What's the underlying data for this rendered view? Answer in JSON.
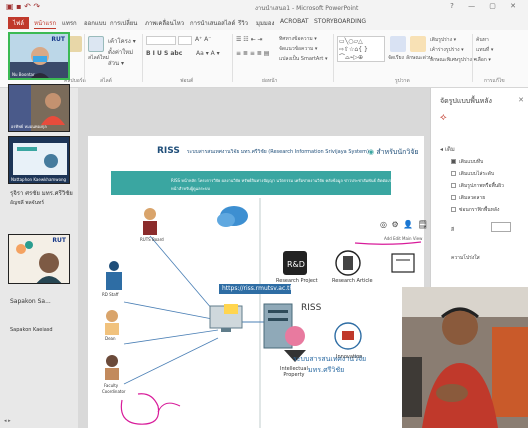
{
  "titlebar": {
    "title": "งานนำเสนอ1 - Microsoft PowerPoint",
    "window_buttons": "? — ▢ ✕"
  },
  "ribbon_tabs": [
    {
      "label": "ไฟล์",
      "kind": "file"
    },
    {
      "label": "หน้าแรก",
      "kind": "active"
    },
    {
      "label": "แทรก"
    },
    {
      "label": "ออกแบบ"
    },
    {
      "label": "การเปลี่ยน"
    },
    {
      "label": "ภาพเคลื่อนไหว"
    },
    {
      "label": "การนำเสนอสไลด์"
    },
    {
      "label": "รีวิว"
    },
    {
      "label": "มุมมอง"
    },
    {
      "label": "ACROBAT"
    },
    {
      "label": "STORYBOARDING"
    }
  ],
  "ribbon": {
    "groups": [
      {
        "label": "คลิปบอร์ด"
      },
      {
        "label": "สไลด์"
      },
      {
        "label": "ฟอนต์"
      },
      {
        "label": "ย่อหน้า"
      },
      {
        "label": "รูปวาด"
      },
      {
        "label": "การแก้ไข"
      }
    ],
    "tools": {
      "new_slide": "สไลด์ใหม่",
      "layout": "เค้าโครง ▾",
      "reset": "ตั้งค่าใหม่",
      "section": "ส่วน ▾",
      "text_direction": "ทิศทางข้อความ ▾",
      "align_text": "จัดแนวข้อความ ▾",
      "smartart": "แปลงเป็น SmartArt ▾",
      "arrange": "จัดเรียง",
      "quick_styles": "ลักษณะด่วน",
      "shape_fill": "เติมรูปร่าง ▾",
      "shape_outline": "เค้าร่างรูปร่าง ▾",
      "shape_effects": "ลักษณะพิเศษรูปร่าง ▾",
      "find": "ค้นหา",
      "replace": "แทนที่ ▾",
      "select": "เลือก ▾"
    }
  },
  "participants": [
    {
      "name": "Nu Boontar",
      "active": true
    },
    {
      "name": "อรทิพย์ หมอนทองกุล"
    },
    {
      "name": "Nattaphon Kaewkhamwong"
    },
    {
      "name": "อัญชลี พลจันทร์"
    }
  ],
  "participant_labels": {
    "label1": "รุจิรา ศรชัย มทร.ศรีวิชัย",
    "label2": "Sapakon Sa...",
    "label3": "Sapakon Kaeiasd"
  },
  "slide": {
    "logo": "RISS",
    "header_title": "ระบบสารสนเทศงานวิจัย มทร.ศรีวิชัย (Research Information Srivijaya System)",
    "researcher_button": "สำหรับนักวิจัย",
    "menu_items": "RISS   หน้าหลัก   โครงการวิจัย   ผลงานวิจัย   ทรัพย์สินทางปัญญา   นวัตกรรม   เครือข่ายงานวิจัย   คลังข้อมูล   ข่าวประชาสัมพันธ์   ติดต่อเรา",
    "menu_sub": "หน้าสำหรับผู้ดูแลระบบ",
    "right_icons": "◎ ⚙ 👤 🗒 👥",
    "add_edit": "Add Edit Main        View",
    "url": "https://riss.rmutsv.ac.th/",
    "server_label": "RISS",
    "system_label_1": "ระบบสารสนเทศงานวิจัย",
    "system_label_2": "มทร.ศรีวิชัย",
    "nodes": {
      "ruts_board": "RUTS Board",
      "rd_staff": "RD Staff",
      "dean": "Dean",
      "faculty": "Faculty",
      "coordinator": "Coordinator",
      "research_project": "Research Project",
      "research_article": "Research Article",
      "intellectual_property": "Intellectual\nProperty",
      "innovation": "Innovation"
    }
  },
  "right_pane": {
    "header": "จัดรูปแบบพื้นหลัง",
    "close": "✕",
    "fill_header": "◂ เติม",
    "options": [
      {
        "label": "เติมแบบทึบ",
        "checked": true
      },
      {
        "label": "เติมแบบไล่ระดับ"
      },
      {
        "label": "เติมรูปภาพหรือพื้นผิว"
      },
      {
        "label": "เติมลวดลาย"
      },
      {
        "label": "ซ่อนกราฟิกพื้นหลัง"
      }
    ],
    "color_label": "สี",
    "transparency_label": "ความโปร่งใส"
  },
  "colors": {
    "accent": "#c0392b",
    "teal_bar": "#3aa6a1",
    "riss_blue": "#1f4e79",
    "url_blue": "#2e6da4",
    "pen_magenta": "#d81b9a",
    "active_tile": "#3cba54"
  }
}
